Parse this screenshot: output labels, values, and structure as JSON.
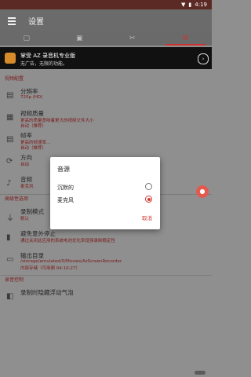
{
  "status": {
    "time": "4:19"
  },
  "appbar": {
    "title": "设置"
  },
  "tabs": [
    {
      "icon": "camera-icon"
    },
    {
      "icon": "image-icon"
    },
    {
      "icon": "tools-icon"
    },
    {
      "icon": "gear-icon",
      "active": true
    }
  ],
  "ad": {
    "title": "掌受 AZ 录音机专业版",
    "subtitle": "无广告，无限的功能。"
  },
  "sections": {
    "video": "视频配置",
    "advanced": "高级性选项",
    "record_control": "录音控制"
  },
  "rows": [
    {
      "title": "分辨率",
      "sub": "720p (HD)"
    },
    {
      "title": "视频质量",
      "sub": "更高的质量意味着更大的视频文件大小",
      "sub2": "自动（推荐）"
    },
    {
      "title": "帧率",
      "sub": "更高的帧速率...",
      "sub2": "自动（推荐）"
    },
    {
      "title": "方向",
      "sub": "自动"
    },
    {
      "title": "音频",
      "sub": "麦克风"
    },
    {
      "title": "录制模式",
      "sub": "默认"
    },
    {
      "title": "避免意外停止",
      "sub": "通过关闭此应用的系统电池优化来增强录制稳定性"
    },
    {
      "title": "输出目录",
      "sub": "/storage/emulated/0/Movies/AzScreenRecorder",
      "sub2": "内部存储（可用剩 04:10:27）"
    },
    {
      "title": "录制时隐藏浮动气泡"
    }
  ],
  "dialog": {
    "title": "音源",
    "options": [
      {
        "label": "沉默的",
        "selected": false
      },
      {
        "label": "麦克风",
        "selected": true
      }
    ],
    "cancel": "取消"
  },
  "colors": {
    "accent": "#d43b36"
  }
}
